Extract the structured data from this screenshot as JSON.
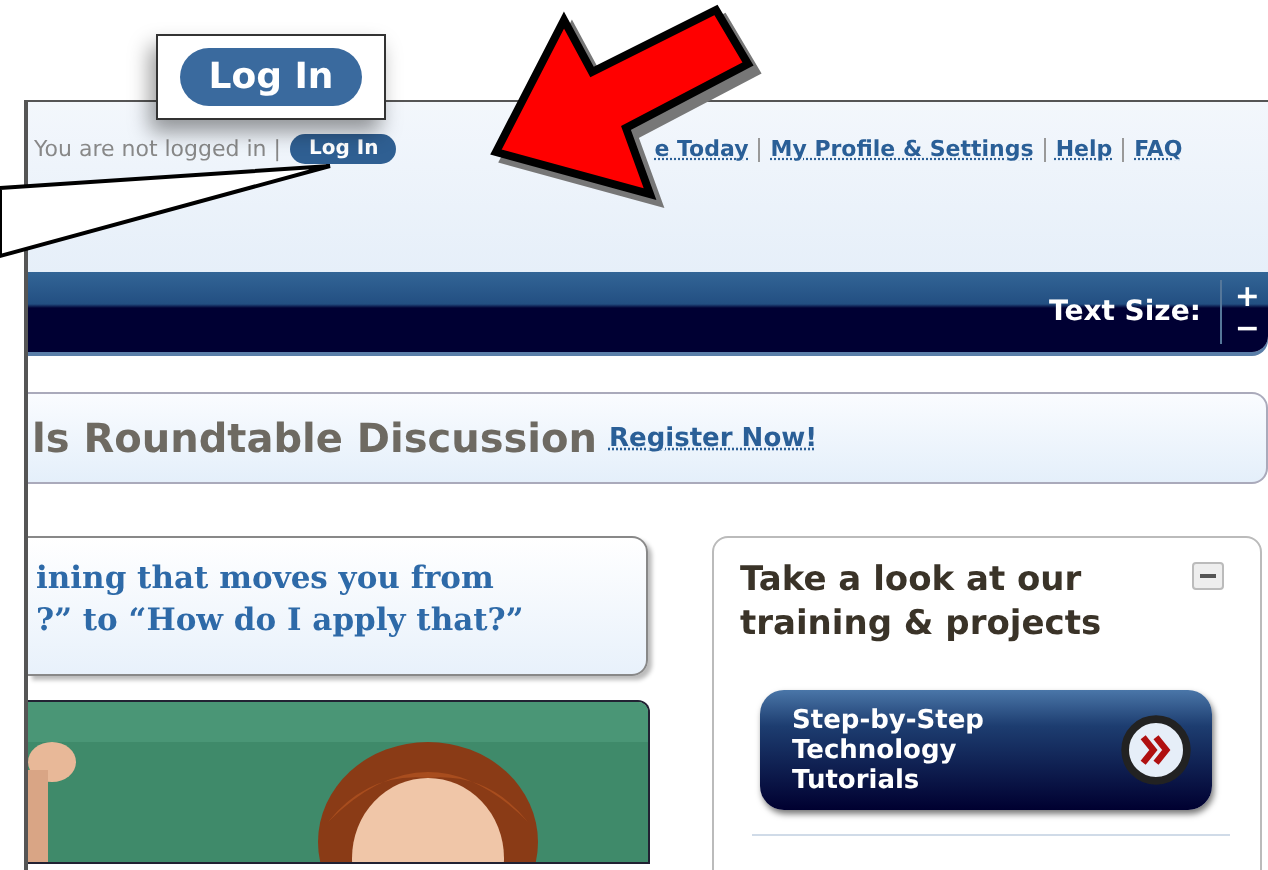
{
  "callout": {
    "button": "Log In"
  },
  "header": {
    "status": "You are not logged in |",
    "login_button": "Log In",
    "links": [
      "e Today",
      "My Profile & Settings",
      "Help",
      "FAQ"
    ]
  },
  "navbar": {
    "text_size_label": "Text Size:",
    "increase": "+",
    "decrease": "−"
  },
  "banner": {
    "title": "ls Roundtable Discussion",
    "link": "Register Now!"
  },
  "quote": {
    "lines": [
      "ining that moves you from",
      "?” to “How do I apply that?”"
    ]
  },
  "sidebar": {
    "title": "Take a look at our training & projects",
    "button_lines": [
      "Step-by-Step",
      "Technology",
      "Tutorials"
    ]
  }
}
